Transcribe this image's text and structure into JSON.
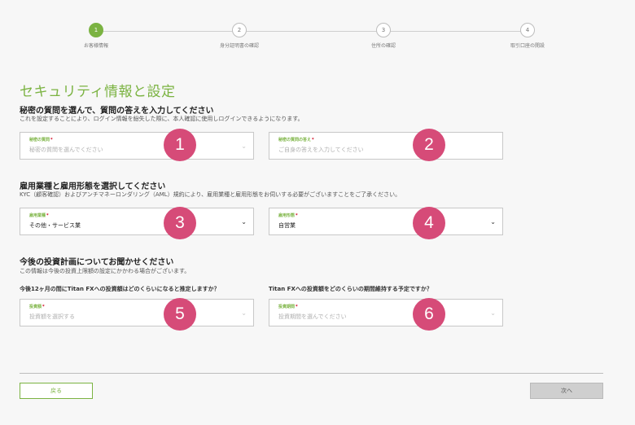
{
  "stepper": {
    "steps": [
      {
        "number": "1",
        "label": "お客様情報"
      },
      {
        "number": "2",
        "label": "身分証明書の確認"
      },
      {
        "number": "3",
        "label": "住所の確認"
      },
      {
        "number": "4",
        "label": "取引口座の開設"
      }
    ]
  },
  "page_title": "セキュリティ情報と設定",
  "security": {
    "heading": "秘密の質問を選んで、質問の答えを入力してください",
    "description": "これを設定することにより、ログイン情報を紛失した際に、本人確認に使用しログインできるようになります。",
    "question_field": {
      "label": "秘密の質問",
      "placeholder": "秘密の質問を選んでください"
    },
    "answer_field": {
      "label": "秘密の質問の答え",
      "placeholder": "ご自身の答えを入力してください"
    }
  },
  "employment": {
    "heading": "雇用業種と雇用形態を選択してください",
    "description": "KYC（顧客確認）およびアンチマネーロンダリング（AML）規約により、雇用業種と雇用形態をお伺いする必要がございますことをご了承ください。",
    "industry_field": {
      "label": "雇用業種",
      "value": "その他・サービス業"
    },
    "type_field": {
      "label": "雇用形態",
      "value": "自営業"
    }
  },
  "investment": {
    "heading": "今後の投資計画についてお聞かせください",
    "description": "この情報は今後の投資上限額の設定にかかわる場合がございます。",
    "question_amount": "今後12ヶ月の間にTitan FXへの投資額はどのくらいになると推定しますか？",
    "question_period": "Titan FXへの投資額をどのくらいの期間維持する予定ですか？",
    "amount_field": {
      "label": "投資額",
      "placeholder": "投資額を選択する"
    },
    "period_field": {
      "label": "投資期間",
      "placeholder": "投資期間を選んでください"
    }
  },
  "badges": [
    "1",
    "2",
    "3",
    "4",
    "5",
    "6"
  ],
  "colors": {
    "accent": "#7bb342",
    "badge": "#d64b78",
    "required": "#d0021b"
  },
  "buttons": {
    "back": "戻る",
    "next": "次へ"
  }
}
